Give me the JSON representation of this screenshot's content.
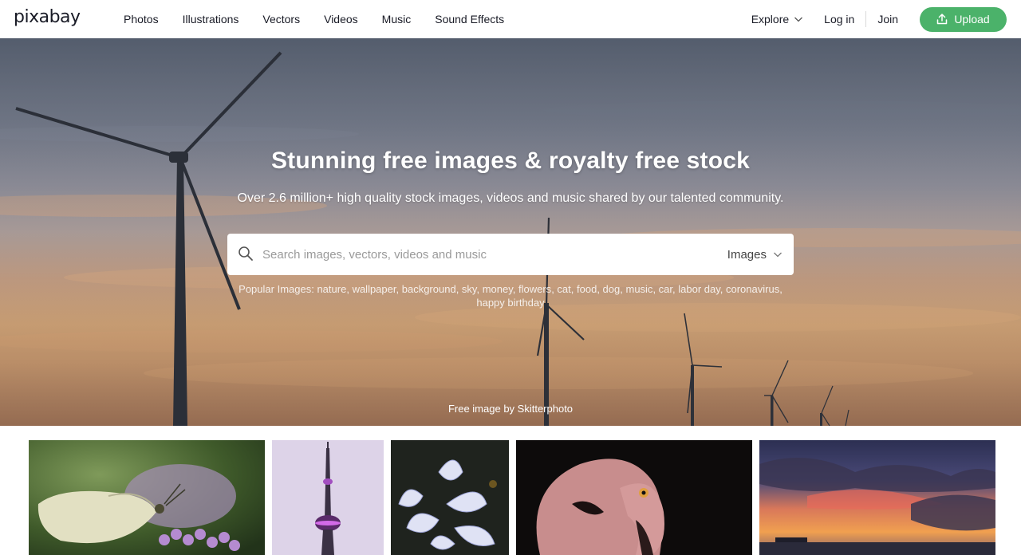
{
  "header": {
    "logo": "pixabay",
    "nav": [
      "Photos",
      "Illustrations",
      "Vectors",
      "Videos",
      "Music",
      "Sound Effects"
    ],
    "explore_label": "Explore",
    "login_label": "Log in",
    "join_label": "Join",
    "upload_label": "Upload",
    "upload_color": "#4bb26a"
  },
  "hero": {
    "title": "Stunning free images & royalty free stock",
    "subtitle": "Over 2.6 million+ high quality stock images, videos and music shared by our talented community.",
    "search_placeholder": "Search images, vectors, videos and music",
    "search_value": "",
    "type_selected": "Images",
    "popular_label": "Popular Images:",
    "popular_tags": [
      "nature",
      "wallpaper",
      "background",
      "sky",
      "money",
      "flowers",
      "cat",
      "food",
      "dog",
      "music",
      "car",
      "labor day",
      "coronavirus",
      "happy birthday"
    ],
    "credit": "Free image by Skitterphoto"
  },
  "gallery": {
    "tiles": [
      {
        "subject": "butterfly on purple flower"
      },
      {
        "subject": "CN tower"
      },
      {
        "subject": "white agapanthus flowers"
      },
      {
        "subject": "flamingo"
      },
      {
        "subject": "sunset sky over sea"
      }
    ]
  }
}
